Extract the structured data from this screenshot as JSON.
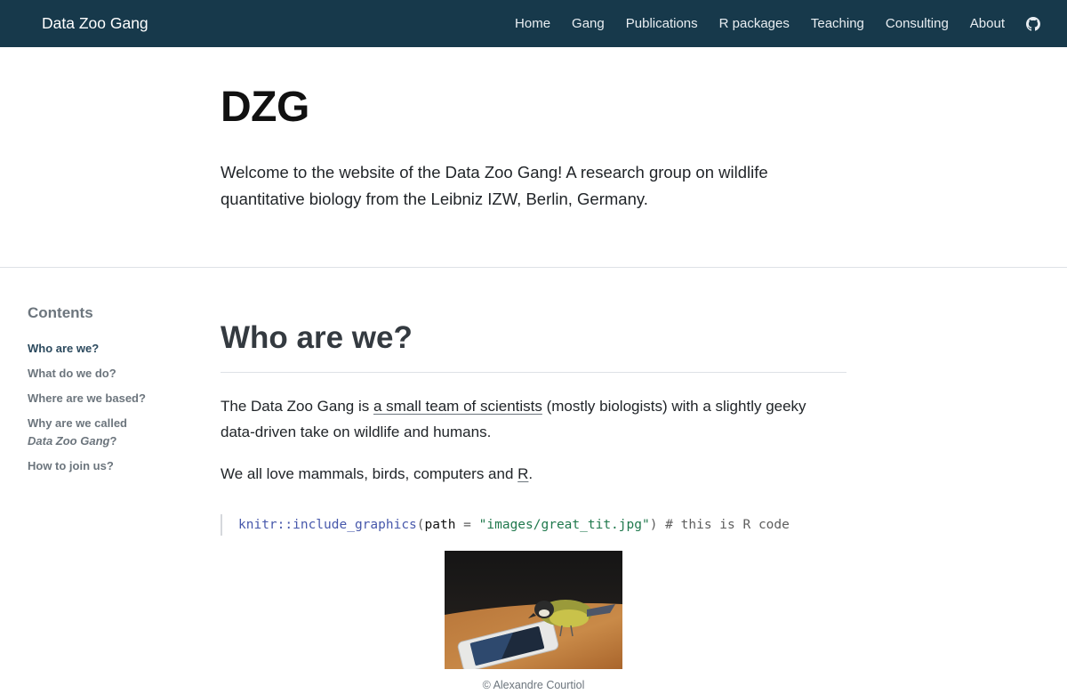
{
  "navbar": {
    "brand": "Data Zoo Gang",
    "links": [
      "Home",
      "Gang",
      "Publications",
      "R packages",
      "Teaching",
      "Consulting",
      "About"
    ],
    "github_icon": "github-icon",
    "background": "#17394b"
  },
  "hero": {
    "title": "DZG",
    "description": "Welcome to the website of the Data Zoo Gang! A research group on wildlife quantitative biology from the Leibniz IZW, Berlin, Germany."
  },
  "toc": {
    "title": "Contents",
    "items": [
      {
        "label": "Who are we?",
        "active": true
      },
      {
        "label": "What do we do?",
        "active": false
      },
      {
        "label": "Where are we based?",
        "active": false
      },
      {
        "label_prefix": "Why are we called",
        "label_em": "Data Zoo Gang",
        "label_suffix": "?",
        "active": false
      },
      {
        "label": "How to join us?",
        "active": false
      }
    ]
  },
  "main": {
    "section_title": "Who are we?",
    "para1": {
      "before": "The Data Zoo Gang is ",
      "link": "a small team of scientists",
      "after": " (mostly biologists) with a slightly geeky data-driven take on wildlife and humans."
    },
    "para2": {
      "before": "We all love mammals, birds, computers and ",
      "link": "R",
      "after": "."
    },
    "code": {
      "fn": "knitr::include_graphics",
      "open": "(",
      "arg": "path",
      "eq": " = ",
      "str": "\"images/great_tit.jpg\"",
      "close": ")",
      "comment": " # this is R code"
    },
    "figure": {
      "caption": "© Alexandre Courtiol"
    }
  }
}
